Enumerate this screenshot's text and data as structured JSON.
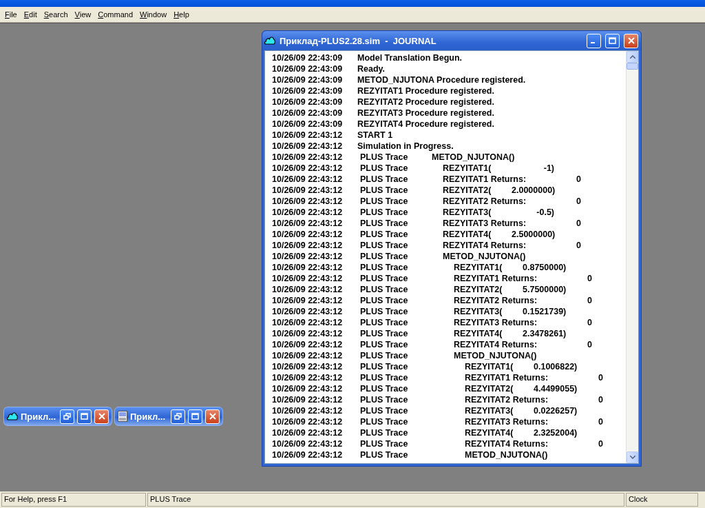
{
  "menu": [
    "File",
    "Edit",
    "Search",
    "View",
    "Command",
    "Window",
    "Help"
  ],
  "journal_window": {
    "title": "Приклад-PLUS2.28.sim  -  JOURNAL",
    "entries": [
      {
        "kind": "message",
        "time": "10/26/09 22:43:09",
        "text": "Model Translation Begun."
      },
      {
        "kind": "message",
        "time": "10/26/09 22:43:09",
        "text": "Ready."
      },
      {
        "kind": "message",
        "time": "10/26/09 22:43:09",
        "text": "METOD_NJUTONA Procedure registered."
      },
      {
        "kind": "message",
        "time": "10/26/09 22:43:09",
        "text": "REZYITAT1 Procedure registered."
      },
      {
        "kind": "message",
        "time": "10/26/09 22:43:09",
        "text": "REZYITAT2 Procedure registered."
      },
      {
        "kind": "message",
        "time": "10/26/09 22:43:09",
        "text": "REZYITAT3 Procedure registered."
      },
      {
        "kind": "message",
        "time": "10/26/09 22:43:09",
        "text": "REZYITAT4 Procedure registered."
      },
      {
        "kind": "message",
        "time": "10/26/09 22:43:12",
        "text": "START 1"
      },
      {
        "kind": "message",
        "time": "10/26/09 22:43:12",
        "text": "Simulation in Progress."
      },
      {
        "kind": "procedure",
        "time": "10/26/09 22:43:12",
        "source": "PLUS Trace",
        "name": "METOD_NJUTONA()",
        "children": [
          {
            "kind": "call",
            "time": "10/26/09 22:43:12",
            "source": "PLUS Trace",
            "name": "REZYITAT1(",
            "value": "-1)"
          },
          {
            "kind": "return",
            "time": "10/26/09 22:43:12",
            "source": "PLUS Trace",
            "name": "REZYITAT1 Returns:",
            "value": "0"
          },
          {
            "kind": "call",
            "time": "10/26/09 22:43:12",
            "source": "PLUS Trace",
            "name": "REZYITAT2(",
            "value": "2.0000000)"
          },
          {
            "kind": "return",
            "time": "10/26/09 22:43:12",
            "source": "PLUS Trace",
            "name": "REZYITAT2 Returns:",
            "value": "0"
          },
          {
            "kind": "call",
            "time": "10/26/09 22:43:12",
            "source": "PLUS Trace",
            "name": "REZYITAT3(",
            "value": "-0.5)"
          },
          {
            "kind": "return",
            "time": "10/26/09 22:43:12",
            "source": "PLUS Trace",
            "name": "REZYITAT3 Returns:",
            "value": "0"
          },
          {
            "kind": "call",
            "time": "10/26/09 22:43:12",
            "source": "PLUS Trace",
            "name": "REZYITAT4(",
            "value": "2.5000000)"
          },
          {
            "kind": "return",
            "time": "10/26/09 22:43:12",
            "source": "PLUS Trace",
            "name": "REZYITAT4 Returns:",
            "value": "0"
          },
          {
            "kind": "procedure",
            "time": "10/26/09 22:43:12",
            "source": "PLUS Trace",
            "name": "METOD_NJUTONA()",
            "children": [
              {
                "kind": "call",
                "time": "10/26/09 22:43:12",
                "source": "PLUS Trace",
                "name": "REZYITAT1(",
                "value": "0.8750000)"
              },
              {
                "kind": "return",
                "time": "10/26/09 22:43:12",
                "source": "PLUS Trace",
                "name": "REZYITAT1 Returns:",
                "value": "0"
              },
              {
                "kind": "call",
                "time": "10/26/09 22:43:12",
                "source": "PLUS Trace",
                "name": "REZYITAT2(",
                "value": "5.7500000)"
              },
              {
                "kind": "return",
                "time": "10/26/09 22:43:12",
                "source": "PLUS Trace",
                "name": "REZYITAT2 Returns:",
                "value": "0"
              },
              {
                "kind": "call",
                "time": "10/26/09 22:43:12",
                "source": "PLUS Trace",
                "name": "REZYITAT3(",
                "value": "0.1521739)"
              },
              {
                "kind": "return",
                "time": "10/26/09 22:43:12",
                "source": "PLUS Trace",
                "name": "REZYITAT3 Returns:",
                "value": "0"
              },
              {
                "kind": "call",
                "time": "10/26/09 22:43:12",
                "source": "PLUS Trace",
                "name": "REZYITAT4(",
                "value": "2.3478261)"
              },
              {
                "kind": "return",
                "time": "10/26/09 22:43:12",
                "source": "PLUS Trace",
                "name": "REZYITAT4 Returns:",
                "value": "0"
              },
              {
                "kind": "procedure",
                "time": "10/26/09 22:43:12",
                "source": "PLUS Trace",
                "name": "METOD_NJUTONA()",
                "children": [
                  {
                    "kind": "call",
                    "time": "10/26/09 22:43:12",
                    "source": "PLUS Trace",
                    "name": "REZYITAT1(",
                    "value": "0.1006822)"
                  },
                  {
                    "kind": "return",
                    "time": "10/26/09 22:43:12",
                    "source": "PLUS Trace",
                    "name": "REZYITAT1 Returns:",
                    "value": "0"
                  },
                  {
                    "kind": "call",
                    "time": "10/26/09 22:43:12",
                    "source": "PLUS Trace",
                    "name": "REZYITAT2(",
                    "value": "4.4499055)"
                  },
                  {
                    "kind": "return",
                    "time": "10/26/09 22:43:12",
                    "source": "PLUS Trace",
                    "name": "REZYITAT2 Returns:",
                    "value": "0"
                  },
                  {
                    "kind": "call",
                    "time": "10/26/09 22:43:12",
                    "source": "PLUS Trace",
                    "name": "REZYITAT3(",
                    "value": "0.0226257)"
                  },
                  {
                    "kind": "return",
                    "time": "10/26/09 22:43:12",
                    "source": "PLUS Trace",
                    "name": "REZYITAT3 Returns:",
                    "value": "0"
                  },
                  {
                    "kind": "call",
                    "time": "10/26/09 22:43:12",
                    "source": "PLUS Trace",
                    "name": "REZYITAT4(",
                    "value": "2.3252004)"
                  },
                  {
                    "kind": "return",
                    "time": "10/26/09 22:43:12",
                    "source": "PLUS Trace",
                    "name": "REZYITAT4 Returns:",
                    "value": "0"
                  },
                  {
                    "kind": "procedure",
                    "time": "10/26/09 22:43:12",
                    "source": "PLUS Trace",
                    "name": "METOD_NJUTONA()"
                  }
                ]
              }
            ]
          }
        ]
      }
    ]
  },
  "minimized_windows": [
    {
      "kind": "model",
      "title": "Прикл..."
    },
    {
      "kind": "report",
      "title": "Прикл..."
    }
  ],
  "status_bar": [
    "For Help, press F1",
    "PLUS Trace",
    "Clock"
  ]
}
